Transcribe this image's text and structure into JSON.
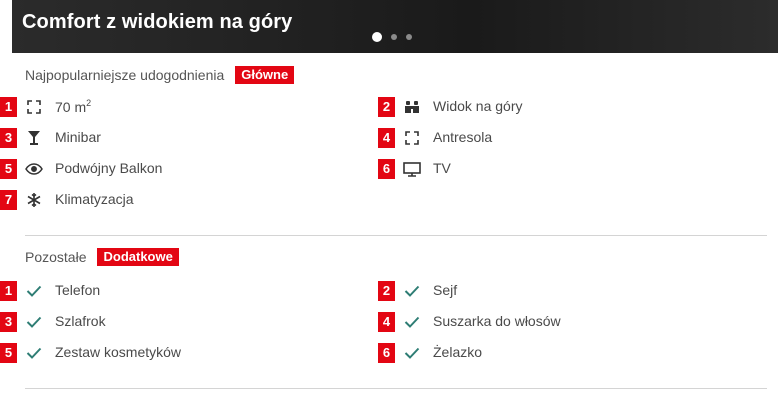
{
  "hero": {
    "title": "Comfort z widokiem na góry",
    "slides": [
      {
        "active": true
      },
      {
        "active": false
      },
      {
        "active": false
      }
    ]
  },
  "main": {
    "heading": "Najpopularniejsze udogodnienia",
    "badge": "Główne",
    "items": [
      {
        "num": "1",
        "icon": "area-icon",
        "label": "70 m",
        "sup": "2"
      },
      {
        "num": "2",
        "icon": "binoculars-icon",
        "label": "Widok na góry"
      },
      {
        "num": "3",
        "icon": "cocktail-glass-icon",
        "label": "Minibar"
      },
      {
        "num": "4",
        "icon": "area-icon",
        "label": "Antresola"
      },
      {
        "num": "5",
        "icon": "eye-icon",
        "label": "Podwójny Balkon"
      },
      {
        "num": "6",
        "icon": "monitor-icon",
        "label": "TV"
      },
      {
        "num": "7",
        "icon": "snowflake-icon",
        "label": "Klimatyzacja"
      }
    ]
  },
  "extra": {
    "heading": "Pozostałe",
    "badge": "Dodatkowe",
    "items": [
      {
        "num": "1",
        "icon": "check-icon",
        "label": "Telefon"
      },
      {
        "num": "2",
        "icon": "check-icon",
        "label": "Sejf"
      },
      {
        "num": "3",
        "icon": "check-icon",
        "label": "Szlafrok"
      },
      {
        "num": "4",
        "icon": "check-icon",
        "label": "Suszarka do włosów"
      },
      {
        "num": "5",
        "icon": "check-icon",
        "label": "Zestaw kosmetyków"
      },
      {
        "num": "6",
        "icon": "check-icon",
        "label": "Żelazko"
      }
    ]
  },
  "colors": {
    "badge": "#e30613",
    "check": "#2e7d74",
    "icon": "#333333"
  }
}
